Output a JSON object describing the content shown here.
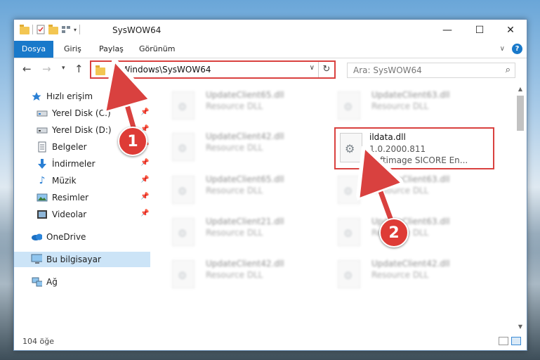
{
  "window": {
    "title": "SysWOW64"
  },
  "ribbon": {
    "tabs": [
      "Dosya",
      "Giriş",
      "Paylaş",
      "Görünüm"
    ]
  },
  "address": {
    "path": "C:\\Windows\\SysWOW64",
    "search_placeholder": "Ara: SysWOW64"
  },
  "nav": {
    "items": [
      {
        "label": "Hızlı erişim",
        "icon": "star-icon"
      },
      {
        "label": "Yerel Disk (C:)",
        "icon": "drive-icon",
        "pinned": true
      },
      {
        "label": "Yerel Disk (D:)",
        "icon": "drive-icon",
        "pinned": true
      },
      {
        "label": "Belgeler",
        "icon": "documents-icon",
        "pinned": true
      },
      {
        "label": "İndirmeler",
        "icon": "download-icon",
        "pinned": true
      },
      {
        "label": "Müzik",
        "icon": "music-icon",
        "pinned": true
      },
      {
        "label": "Resimler",
        "icon": "pictures-icon",
        "pinned": true
      },
      {
        "label": "Videolar",
        "icon": "video-icon",
        "pinned": true
      },
      {
        "label": "OneDrive",
        "icon": "cloud-icon"
      },
      {
        "label": "Bu bilgisayar",
        "icon": "computer-icon",
        "selected": true
      },
      {
        "label": "Ağ",
        "icon": "network-icon"
      }
    ]
  },
  "files": [
    {
      "name": "UpdateClient65.dll",
      "type": "Resource DLL"
    },
    {
      "name": "UpdateClient63.dll",
      "type": "Resource DLL"
    },
    {
      "name": "UpdateClient42.dll",
      "type": "Resource DLL"
    },
    {
      "name": "UpdateClient65.dll",
      "type": "Resource DLL"
    },
    {
      "name": "UpdateClient63.dll",
      "type": "Resource DLL"
    },
    {
      "name": "UpdateClient21.dll",
      "type": "Resource DLL"
    },
    {
      "name": "UpdateClient63.dll",
      "type": "Resource DLL"
    },
    {
      "name": "UpdateClient42.dll",
      "type": "Resource DLL"
    },
    {
      "name": "UpdateClient42.dll",
      "type": "Resource DLL"
    }
  ],
  "highlighted_file": {
    "name": "ildata.dll",
    "version": "1.0.2000.811",
    "company": "Softimage SICORE En..."
  },
  "status": {
    "count": "104 öğe"
  },
  "callouts": [
    "1",
    "2"
  ],
  "colors": {
    "accent": "#1979ca",
    "highlight_red": "#d9413f"
  }
}
